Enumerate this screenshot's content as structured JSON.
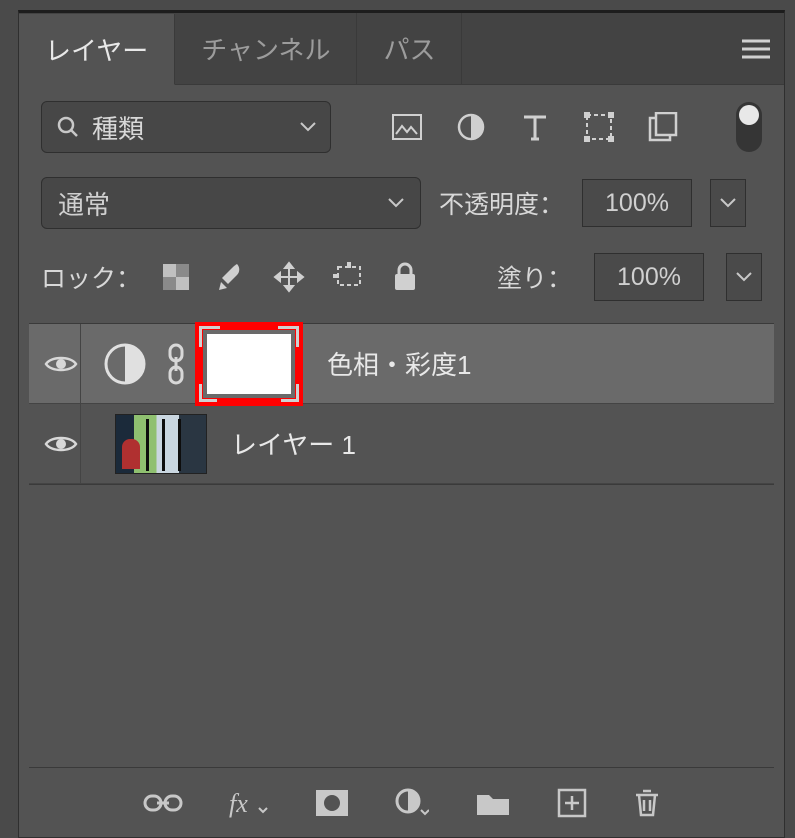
{
  "tabs": {
    "layers": "レイヤー",
    "channels": "チャンネル",
    "paths": "パス"
  },
  "filter": {
    "placeholder": "種類"
  },
  "blend": {
    "mode": "通常",
    "opacity_label": "不透明度：",
    "opacity_value": "100%"
  },
  "lock": {
    "label": "ロック：",
    "fill_label": "塗り：",
    "fill_value": "100%"
  },
  "layers": [
    {
      "name": "色相・彩度1",
      "type": "adjustment"
    },
    {
      "name": "レイヤー 1",
      "type": "image"
    }
  ]
}
